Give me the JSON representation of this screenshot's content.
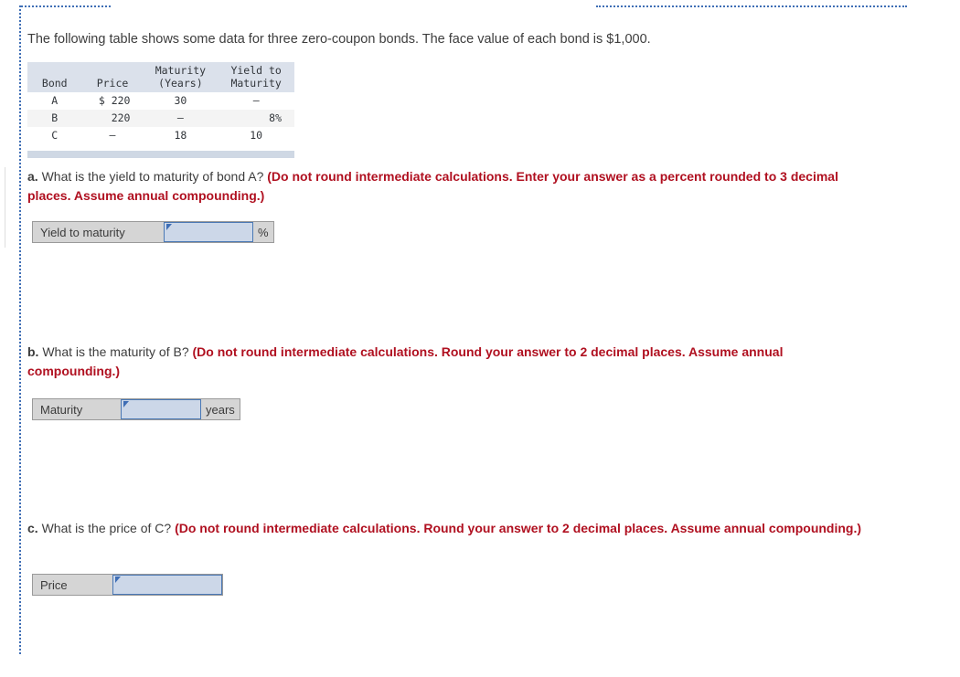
{
  "intro": {
    "text": "The following table shows some data for three zero-coupon bonds. The face value of each bond is $1,000."
  },
  "bond_table": {
    "headers": {
      "bond": "Bond",
      "price": "Price",
      "maturity": "Maturity\n(Years)",
      "ytm": "Yield to\nMaturity"
    },
    "rows": [
      {
        "bond": "A",
        "price": "$ 220",
        "maturity": "30",
        "ytm": "–"
      },
      {
        "bond": "B",
        "price": "220",
        "maturity": "–",
        "ytm": "8%"
      },
      {
        "bond": "C",
        "price": "–",
        "maturity": "18",
        "ytm": "10"
      }
    ]
  },
  "questions": {
    "a": {
      "label": "a.",
      "prompt": " What is the yield to maturity of bond A? ",
      "note": "(Do not round intermediate calculations. Enter your answer as a percent rounded to 3 decimal places. Assume annual compounding.)",
      "answer": {
        "label": "Yield to maturity",
        "value": "",
        "placeholder": "",
        "unit": "%"
      }
    },
    "b": {
      "label": "b.",
      "prompt": " What is the maturity of B? ",
      "note": "(Do not round intermediate calculations. Round your answer to 2 decimal places. Assume annual compounding.)",
      "answer": {
        "label": "Maturity",
        "value": "",
        "placeholder": "",
        "unit": "years"
      }
    },
    "c": {
      "label": "c.",
      "prompt": " What is the price of C? ",
      "note": "(Do not round intermediate calculations. Round your answer to 2 decimal places. Assume annual compounding.)",
      "answer": {
        "label": "Price",
        "value": "",
        "placeholder": "",
        "unit": ""
      }
    }
  },
  "colors": {
    "note_red": "#b01020",
    "guide_blue": "#3f6eb5",
    "table_header_bg": "#dbe1eb",
    "input_blue_bg": "#ccd7e8",
    "input_blue_border": "#4a78b5",
    "widget_gray": "#d5d5d5"
  }
}
